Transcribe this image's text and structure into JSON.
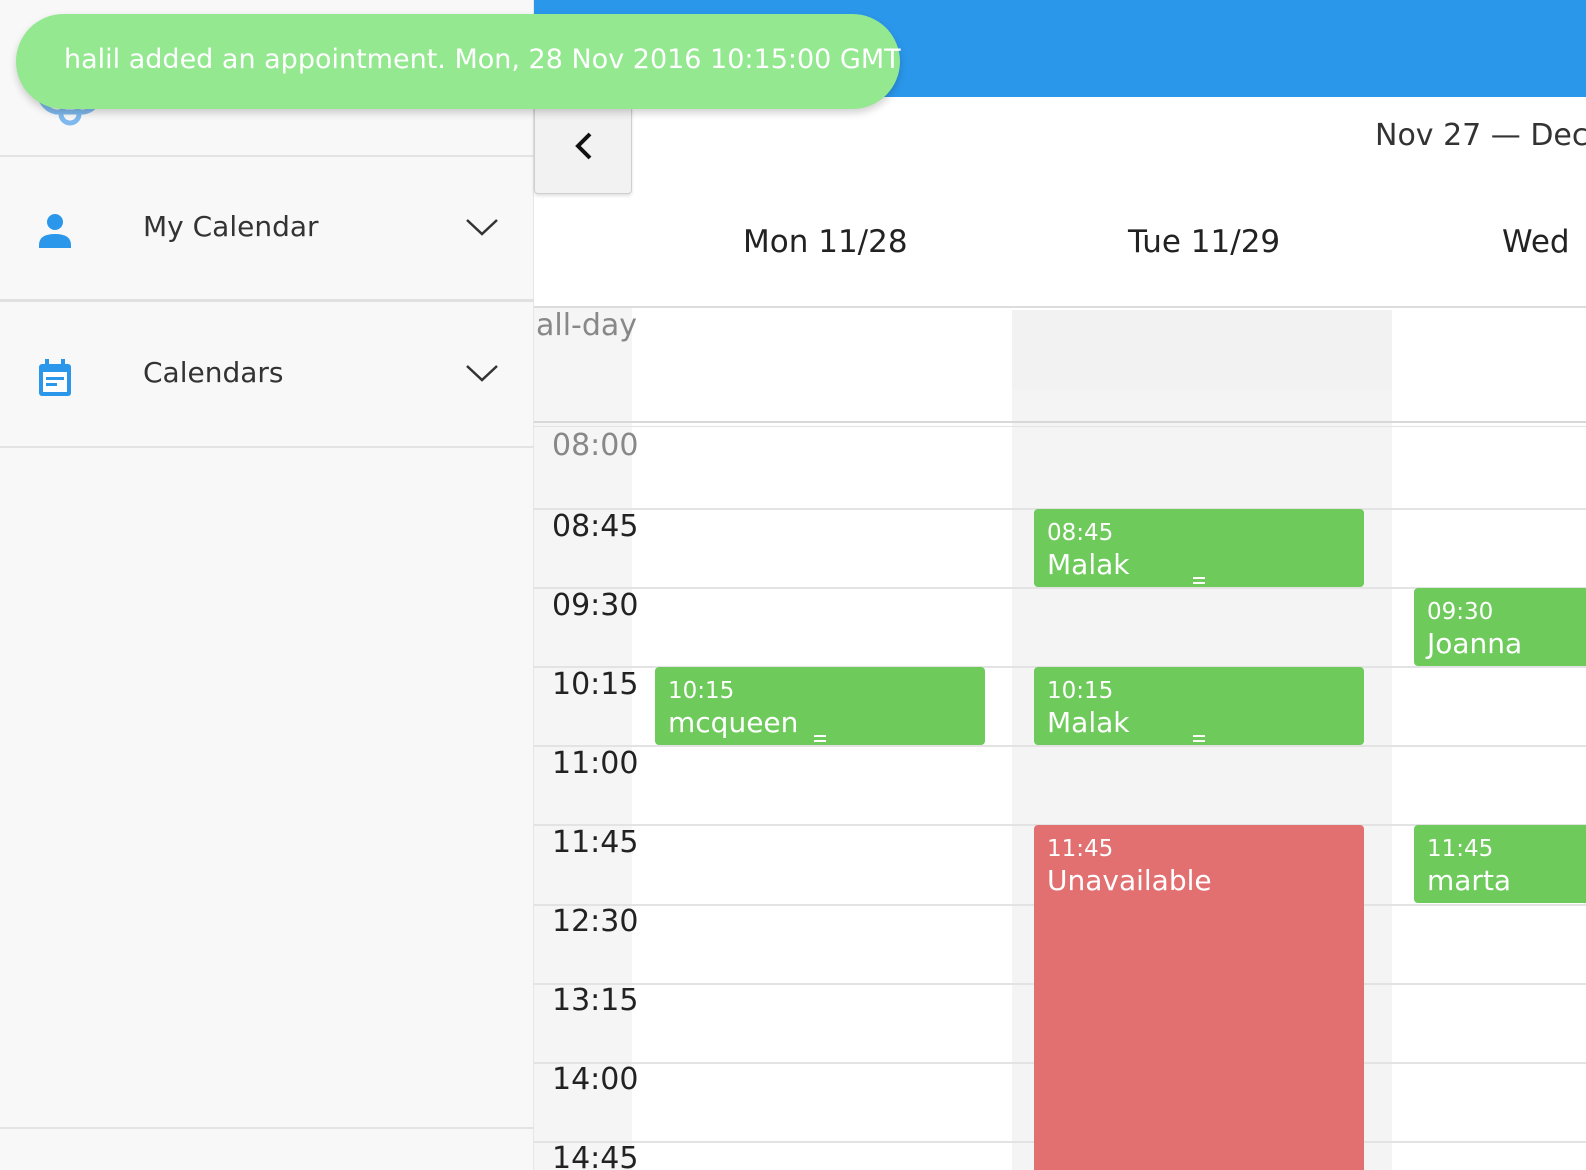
{
  "toast": {
    "message": "halil added an appointment. Mon, 28 Nov 2016 10:15:00 GMT"
  },
  "sidebar": {
    "items": [
      {
        "label": "My Calendar",
        "icon": "person-icon"
      },
      {
        "label": "Calendars",
        "icon": "calendar-icon"
      }
    ]
  },
  "calendar": {
    "range_title": "Nov 27 — Dec",
    "days": [
      "Mon 11/28",
      "Tue 11/29",
      "Wed"
    ],
    "allday_label": "all-day",
    "times": [
      "08:00",
      "08:45",
      "09:30",
      "10:15",
      "11:00",
      "11:45",
      "12:30",
      "13:15",
      "14:00",
      "14:45"
    ],
    "events": [
      {
        "time": "08:45",
        "title": "Malak",
        "status": "booked"
      },
      {
        "time": "09:30",
        "title": "Joanna",
        "status": "booked"
      },
      {
        "time": "10:15",
        "title": "mcqueen",
        "status": "booked"
      },
      {
        "time": "10:15",
        "title": "Malak",
        "status": "booked"
      },
      {
        "time": "11:45",
        "title": "Unavailable",
        "status": "unavailable"
      },
      {
        "time": "11:45",
        "title": "marta",
        "status": "booked"
      }
    ]
  },
  "colors": {
    "topbar": "#2b97eb",
    "event_green": "#6ecb5b",
    "event_red": "#e27071",
    "toast": "#93e890",
    "icon_blue": "#2b97eb"
  }
}
